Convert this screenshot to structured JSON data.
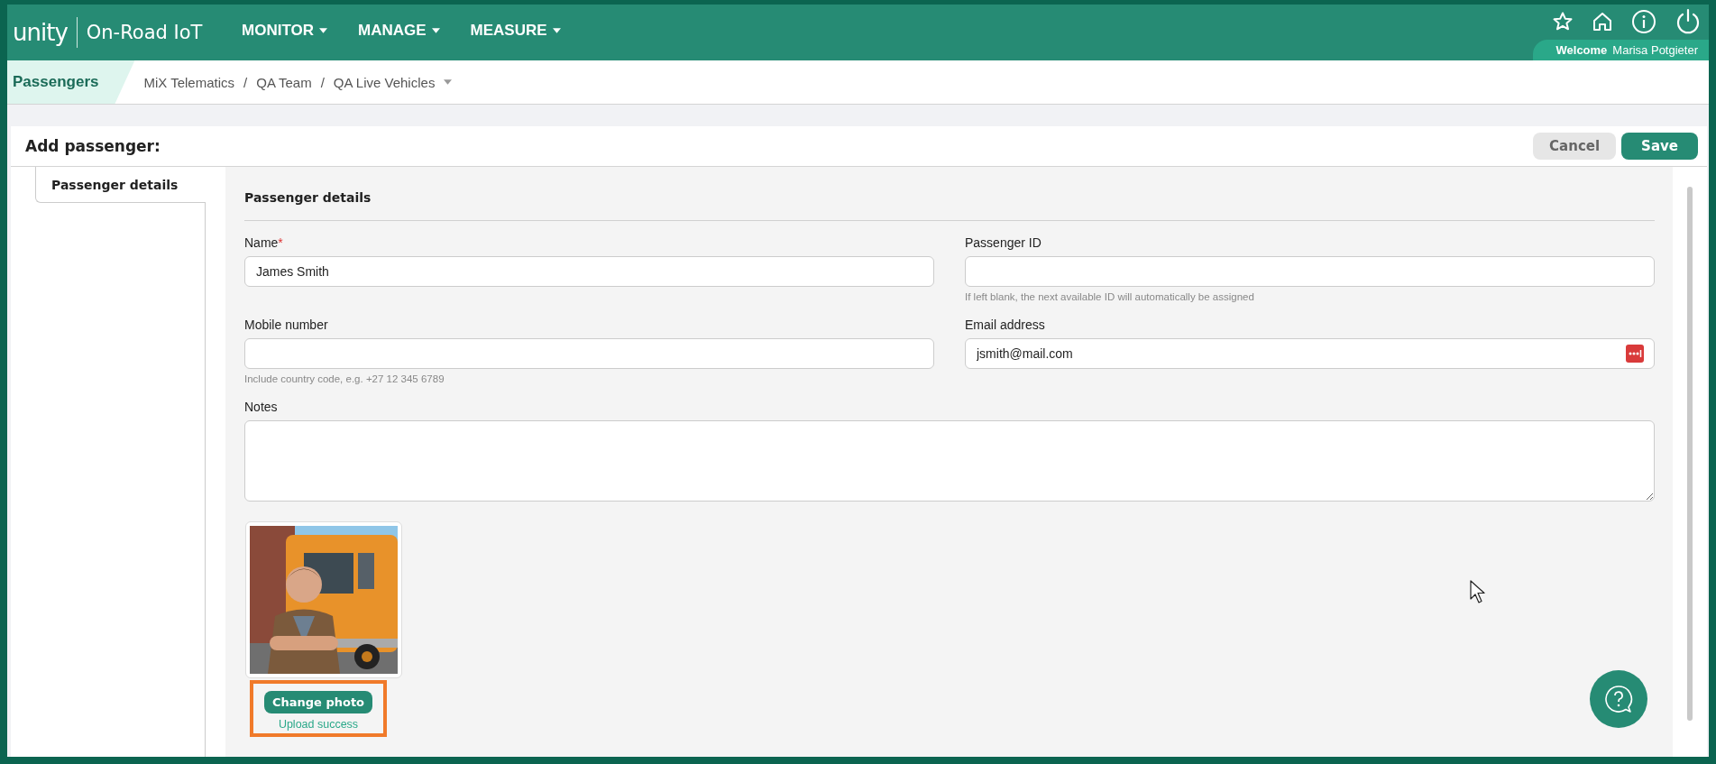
{
  "header": {
    "logo": "unity",
    "product": "On-Road IoT",
    "menus": [
      {
        "label": "MONITOR",
        "dropdown": true
      },
      {
        "label": "MANAGE",
        "dropdown": true
      },
      {
        "label": "MEASURE",
        "dropdown": true
      }
    ],
    "welcome": "Welcome",
    "user": "Marisa Potgieter"
  },
  "breadcrumb": {
    "section": "Passengers",
    "path": [
      {
        "label": "MiX Telematics",
        "dropdown": false
      },
      {
        "separator": "/",
        "label": "QA Team",
        "dropdown": false
      },
      {
        "separator": "/",
        "label": "QA Live Vehicles",
        "dropdown": true
      }
    ]
  },
  "page": {
    "title": "Add passenger:",
    "buttons": [
      {
        "label": "Cancel",
        "kind": "secondary"
      },
      {
        "label": "Save",
        "kind": "primary"
      }
    ]
  },
  "tabs": [
    {
      "label": "Passenger details",
      "selected": true
    }
  ],
  "form": {
    "heading": "Passenger details",
    "fields": [
      {
        "kind": "text",
        "label": "Name",
        "required_mark": "*",
        "value": "James Smith"
      },
      {
        "kind": "text",
        "label": "Passenger ID",
        "hint": "If left blank, the next available ID will automatically be assigned"
      },
      {
        "kind": "text",
        "label": "Mobile number",
        "hint": "Include country code, e.g. +27 12 345 6789"
      },
      {
        "kind": "text",
        "label": "Email address",
        "value": "jsmith@mail.com",
        "autofill_badge": true
      },
      {
        "kind": "textarea",
        "label": "Notes"
      }
    ],
    "photo": {
      "kind": "picture",
      "button": "Change photo",
      "status": "Upload success",
      "highlighted": true
    }
  }
}
